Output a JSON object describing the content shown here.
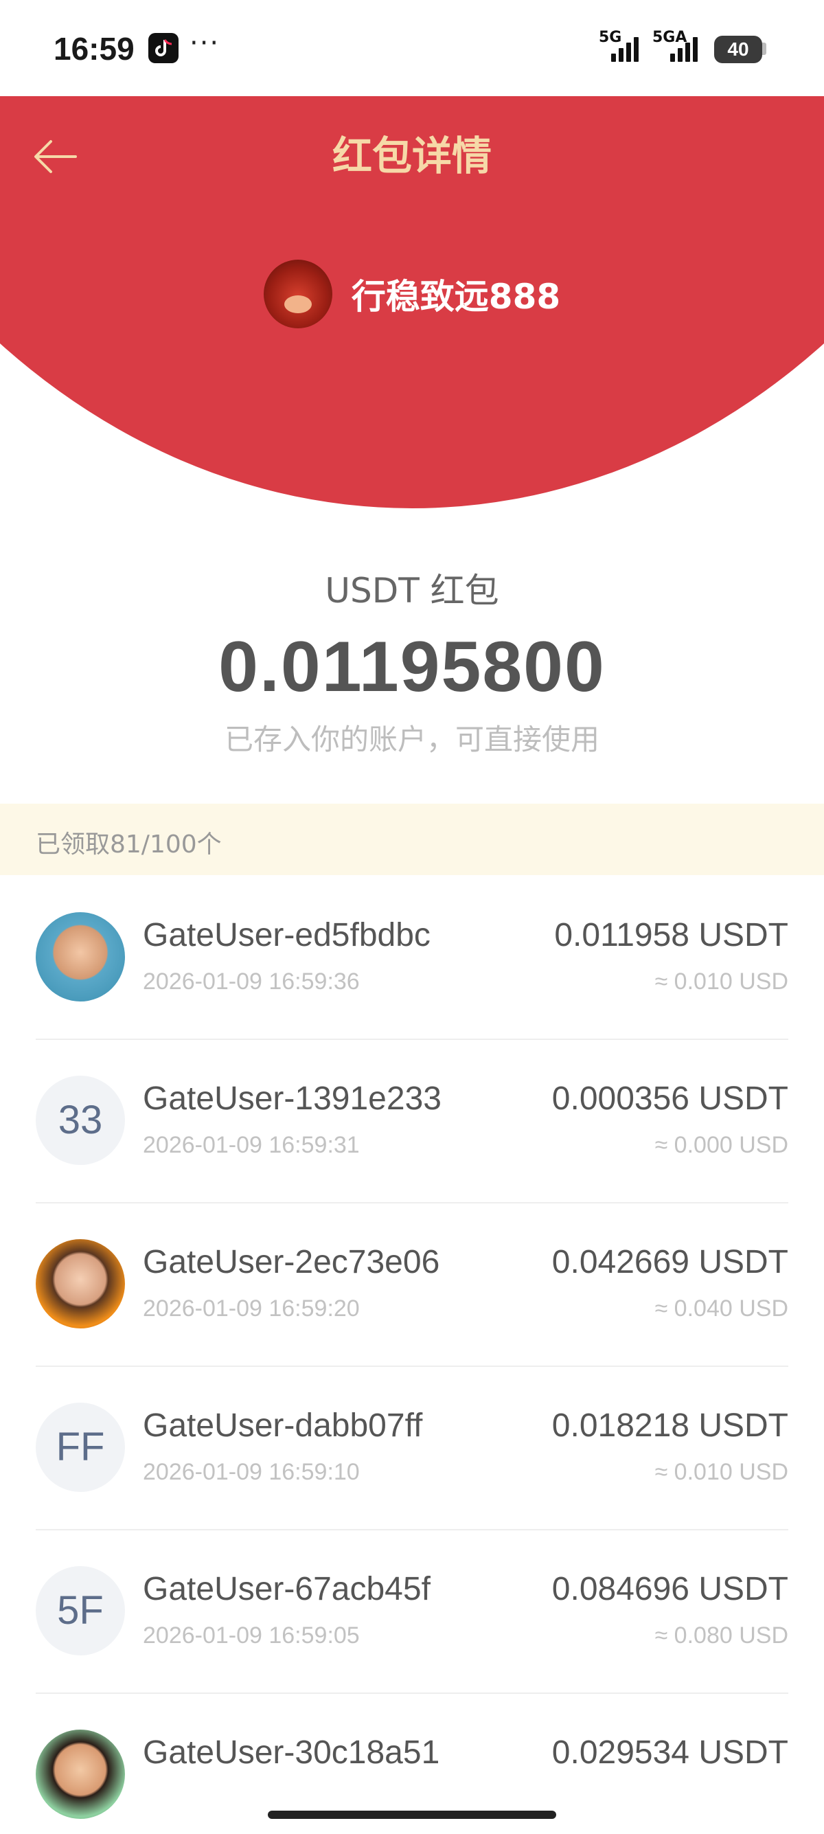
{
  "status_bar": {
    "time": "16:59",
    "dots": "···",
    "network_1": "5G",
    "network_2": "5GA",
    "battery": "40"
  },
  "header": {
    "title": "红包详情",
    "sender_name": "行稳致远888",
    "bg_color": "#d93c45",
    "title_color": "#f6d9a8"
  },
  "packet": {
    "currency_label": "USDT 红包",
    "amount": "0.01195800",
    "note": "已存入你的账户，可直接使用"
  },
  "claimed": {
    "text": "已领取81/100个"
  },
  "records": [
    {
      "avatar": "photo",
      "name": "GateUser-ed5fbdbc",
      "time": "2026-01-09 16:59:36",
      "amount": "0.011958 USDT",
      "usd": "≈ 0.010 USD"
    },
    {
      "avatar": "33",
      "name": "GateUser-1391e233",
      "time": "2026-01-09 16:59:31",
      "amount": "0.000356 USDT",
      "usd": "≈ 0.000 USD"
    },
    {
      "avatar": "photo",
      "name": "GateUser-2ec73e06",
      "time": "2026-01-09 16:59:20",
      "amount": "0.042669 USDT",
      "usd": "≈ 0.040 USD"
    },
    {
      "avatar": "FF",
      "name": "GateUser-dabb07ff",
      "time": "2026-01-09 16:59:10",
      "amount": "0.018218 USDT",
      "usd": "≈ 0.010 USD"
    },
    {
      "avatar": "5F",
      "name": "GateUser-67acb45f",
      "time": "2026-01-09 16:59:05",
      "amount": "0.084696 USDT",
      "usd": "≈ 0.080 USD"
    },
    {
      "avatar": "photo",
      "name": "GateUser-30c18a51",
      "time": "",
      "amount": "0.029534 USDT",
      "usd": ""
    }
  ]
}
